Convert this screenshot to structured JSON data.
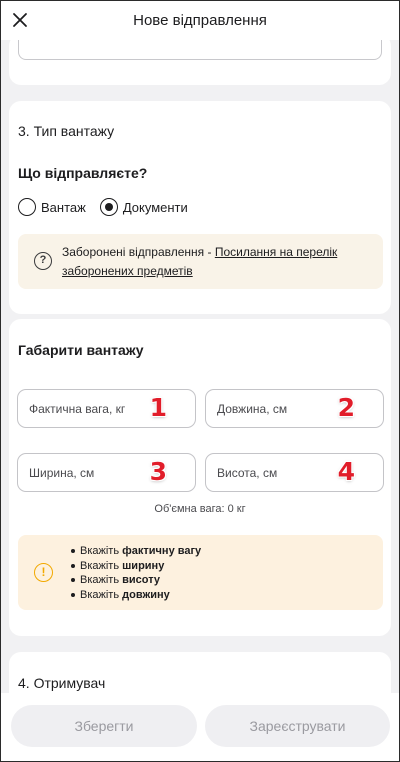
{
  "header": {
    "title": "Нове відправлення"
  },
  "cargo_section": {
    "title": "3. Тип вантажу",
    "question": "Що відправляєте?",
    "options": [
      {
        "label": "Вантаж",
        "selected": false
      },
      {
        "label": "Документи",
        "selected": true
      }
    ],
    "info": {
      "text": "Заборонені відправлення - ",
      "link": "Посилання на перелік заборонених предметів"
    }
  },
  "dims_section": {
    "title": "Габарити вантажу",
    "fields": [
      {
        "placeholder": "Фактична вага, кг",
        "marker": "1"
      },
      {
        "placeholder": "Довжина, см",
        "marker": "2"
      },
      {
        "placeholder": "Ширина, см",
        "marker": "3"
      },
      {
        "placeholder": "Висота, см",
        "marker": "4"
      }
    ],
    "volume_text": "Об'ємна вага: 0 кг",
    "warnings": [
      {
        "prefix": "Вкажіть ",
        "bold": "фактичну вагу"
      },
      {
        "prefix": "Вкажіть ",
        "bold": "ширину"
      },
      {
        "prefix": "Вкажіть ",
        "bold": "висоту"
      },
      {
        "prefix": "Вкажіть ",
        "bold": "довжину"
      }
    ]
  },
  "recipient_section": {
    "title": "4. Отримувач"
  },
  "footer": {
    "save_label": "Зберегти",
    "register_label": "Зареєструвати"
  },
  "colors": {
    "marker": "#e11d2a",
    "warning_icon": "#f2a900",
    "info_bg": "#f9f3e8",
    "warning_bg": "#fdf1df"
  }
}
